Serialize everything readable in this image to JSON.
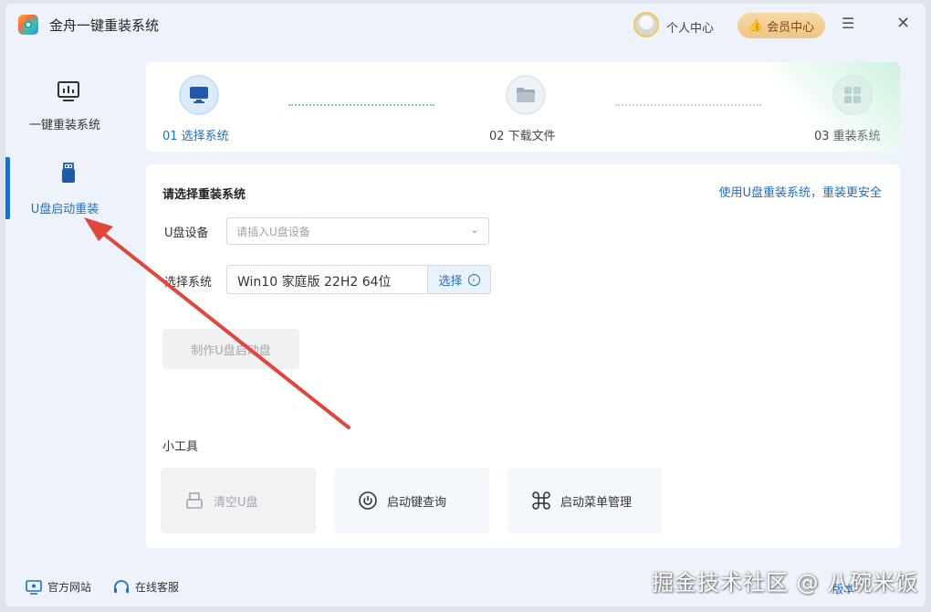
{
  "app": {
    "title": "金舟一键重装系统"
  },
  "header": {
    "user_center": "个人中心",
    "vip_center": "会员中心"
  },
  "sidebar": {
    "items": [
      {
        "label": "一键重装系统",
        "icon": "monitor-chart-icon"
      },
      {
        "label": "U盘启动重装",
        "icon": "usb-drive-icon"
      }
    ],
    "active": "U盘启动重装"
  },
  "steps": [
    {
      "label": "01 选择系统",
      "icon": "monitor-icon",
      "active": true
    },
    {
      "label": "02 下载文件",
      "icon": "folder-icon",
      "active": false
    },
    {
      "label": "03 重装系统",
      "icon": "grid-icon",
      "active": false
    }
  ],
  "main": {
    "section_title": "请选择重装系统",
    "safe_link": "使用U盘重装系统，重装更安全",
    "device_label": "U盘设备",
    "device_placeholder": "请插入U盘设备",
    "system_label": "选择系统",
    "system_value": "Win10 家庭版 22H2 64位",
    "select_button": "选择",
    "make_button": "制作U盘启动盘",
    "tools_title": "小工具",
    "tools": [
      {
        "label": "清空U盘",
        "icon": "usb-clear-icon",
        "enabled": false
      },
      {
        "label": "启动键查询",
        "icon": "power-icon",
        "enabled": true
      },
      {
        "label": "启动菜单管理",
        "icon": "command-icon",
        "enabled": true
      }
    ]
  },
  "footer": {
    "website": "官方网站",
    "support": "在线客服",
    "version_fragment": "版本"
  },
  "watermark": "掘金技术社区 @ 八碗米饭",
  "colors": {
    "accent": "#1e6fc4",
    "annotation_arrow": "#e0463b",
    "vip_gold": "#efc486"
  }
}
